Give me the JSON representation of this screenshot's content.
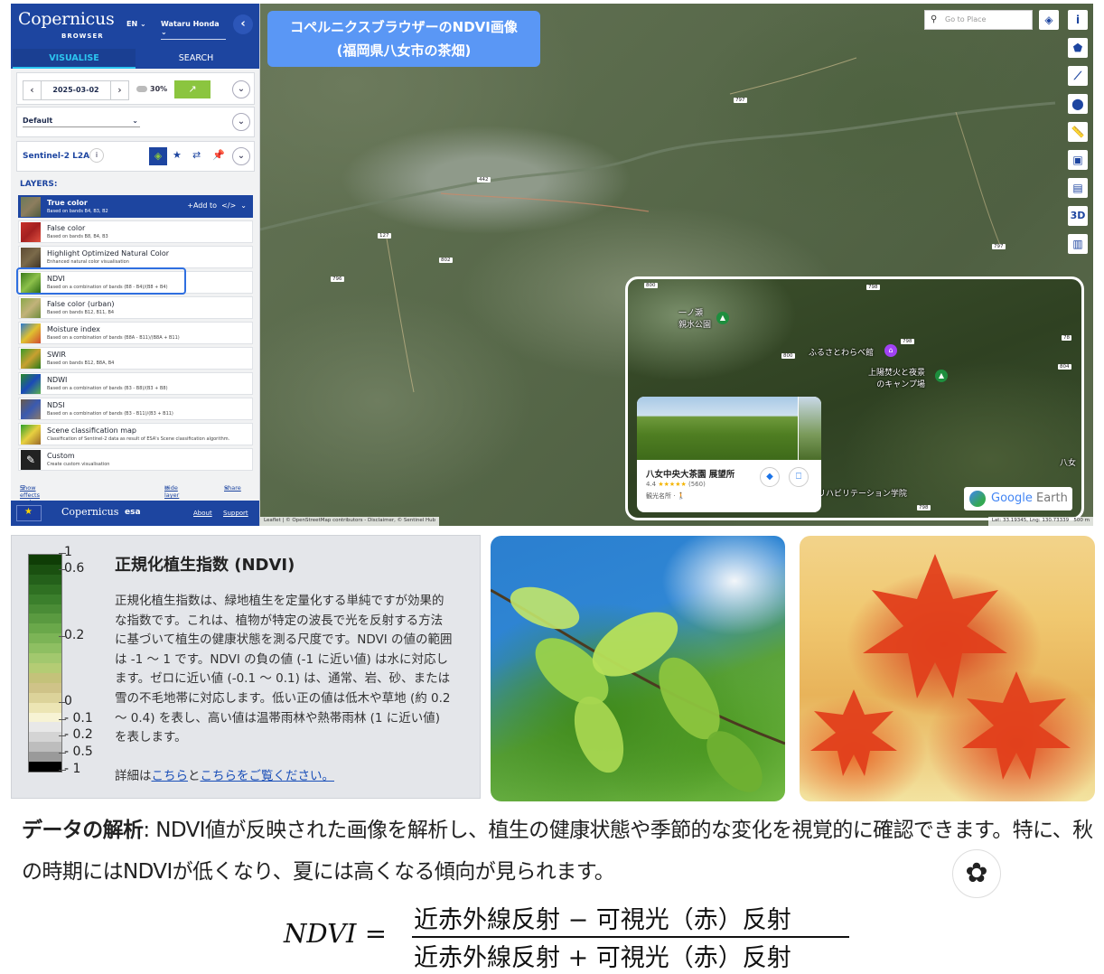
{
  "sidebar": {
    "logo": "Copernicus",
    "logo_sub": "BROWSER",
    "lang": "EN",
    "user": "Wataru Honda",
    "tabs": [
      "VISUALISE",
      "SEARCH"
    ],
    "date": "2025-03-02",
    "cloud": "30%",
    "theme": "Default",
    "collection": "Sentinel-2 L2A",
    "layers_title": "LAYERS:",
    "add_to": "+Add to",
    "layers": [
      {
        "name": "True color",
        "desc": "Based on bands B4, B3, B2"
      },
      {
        "name": "False color",
        "desc": "Based on bands B8, B4, B3"
      },
      {
        "name": "Highlight Optimized Natural Color",
        "desc": "Enhanced natural color visualisation"
      },
      {
        "name": "NDVI",
        "desc": "Based on a combination of bands (B8 - B4)/(B8 + B4)"
      },
      {
        "name": "False color (urban)",
        "desc": "Based on bands B12, B11, B4"
      },
      {
        "name": "Moisture index",
        "desc": "Based on a combination of bands (B8A - B11)/(B8A + B11)"
      },
      {
        "name": "SWIR",
        "desc": "Based on bands B12, B8A, B4"
      },
      {
        "name": "NDWI",
        "desc": "Based on a combination of bands (B3 - B8)/(B3 + B8)"
      },
      {
        "name": "NDSI",
        "desc": "Based on a combination of bands (B3 - B11)/(B3 + B11)"
      },
      {
        "name": "Scene classification map",
        "desc": "Classification of Sentinel-2 data as result of ESA's Scene classification algorithm."
      },
      {
        "name": "Custom",
        "desc": "Create custom visualisation"
      }
    ],
    "links": {
      "effects": "Show effects and advanced options",
      "hide": "Hide layer",
      "share": "Share"
    },
    "footer": {
      "copernicus": "Copernicus",
      "esa": "esa",
      "about": "About",
      "support": "Support"
    }
  },
  "map": {
    "title_line1": "コペルニクスブラウザーのNDVI画像",
    "title_line2": "(福岡県八女市の茶畑)",
    "search_placeholder": "Go to Place",
    "tools": [
      "layers-icon",
      "info-icon",
      "polygon-icon",
      "line-icon",
      "pin-icon",
      "ruler-icon",
      "image-export-icon",
      "timelapse-icon",
      "3D",
      "histogram-icon"
    ],
    "tool_3d": "3D",
    "roads": [
      "797",
      "442",
      "127",
      "802",
      "796",
      "797"
    ],
    "attribution": "Leaflet | © OpenStreetMap contributors - Disclaimer, © Sentinel Hub",
    "coords": "Lat: 33.19345, Lng: 130.73339",
    "scale": "500 m"
  },
  "gearth": {
    "labels": {
      "park": "一ノ瀬\n親水公園",
      "museum": "ふるさとわらべ館",
      "camp": "上陽焚火と夜景\nのキャンプ場",
      "rehab": "リハビリテーション学院",
      "yame": "八女"
    },
    "road_labels": [
      "800",
      "798",
      "800",
      "798",
      "78",
      "804",
      "798"
    ],
    "card": {
      "title": "八女中央大茶園 展望所",
      "rating": "4.4",
      "stars": "★★★★★",
      "count": "(560)",
      "category": "観光名所 · 🚶"
    },
    "logo_google": "Google",
    "logo_earth": " Earth"
  },
  "legend": {
    "ticks": [
      "1",
      "0.6",
      "0.2",
      "0",
      "- 0.1",
      "- 0.2",
      "- 0.5",
      "- 1"
    ],
    "title": "正規化植生指数 (NDVI)",
    "body": "正規化植生指数は、緑地植生を定量化する単純ですが効果的な指数です。これは、植物が特定の波長で光を反射する方法に基づいて植生の健康状態を測る尺度です。NDVI の値の範囲は -1 ～ 1 です。NDVI の負の値 (-1 に近い値) は水に対応します。ゼロに近い値 (-0.1 ～ 0.1) は、通常、岩、砂、または雪の不毛地帯に対応します。低い正の値は低木や草地 (約 0.2 ～ 0.4) を表し、高い値は温帯雨林や熱帯雨林 (1 に近い値) を表します。",
    "more_prefix": "詳細は",
    "more_link1": "こちら",
    "more_mid": "と",
    "more_link2": "こちらをご覧ください。"
  },
  "analysis": {
    "bold": "データの解析",
    "text": ": NDVI値が反映された画像を解析し、植生の健康状態や季節的な変化を視覚的に確認できます。特に、秋の時期にはNDVIが低くなり、夏には高くなる傾向が見られます。"
  },
  "formula": {
    "lhs": "NDVI =",
    "numerator": "近赤外線反射 − 可視光（赤）反射",
    "denominator": "近赤外線反射 + 可視光（赤）反射"
  }
}
